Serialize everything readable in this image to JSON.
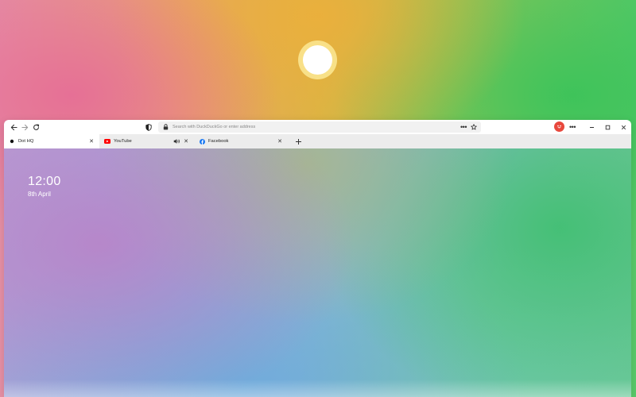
{
  "toolbar": {
    "address_placeholder": "Search with DuckDuckGo or enter address"
  },
  "tabs": [
    {
      "title": "Dot HQ",
      "active": true,
      "favicon": "dot-favicon-icon"
    },
    {
      "title": "YouTube",
      "active": false,
      "favicon": "youtube-favicon-icon",
      "audio": true
    },
    {
      "title": "Facebook",
      "active": false,
      "favicon": "facebook-favicon-icon"
    }
  ],
  "newtab": {
    "time": "12:00",
    "date": "8th April"
  },
  "colors": {
    "avatar": "#e8483d",
    "youtube": "#ff0000",
    "facebook": "#1877f2"
  }
}
